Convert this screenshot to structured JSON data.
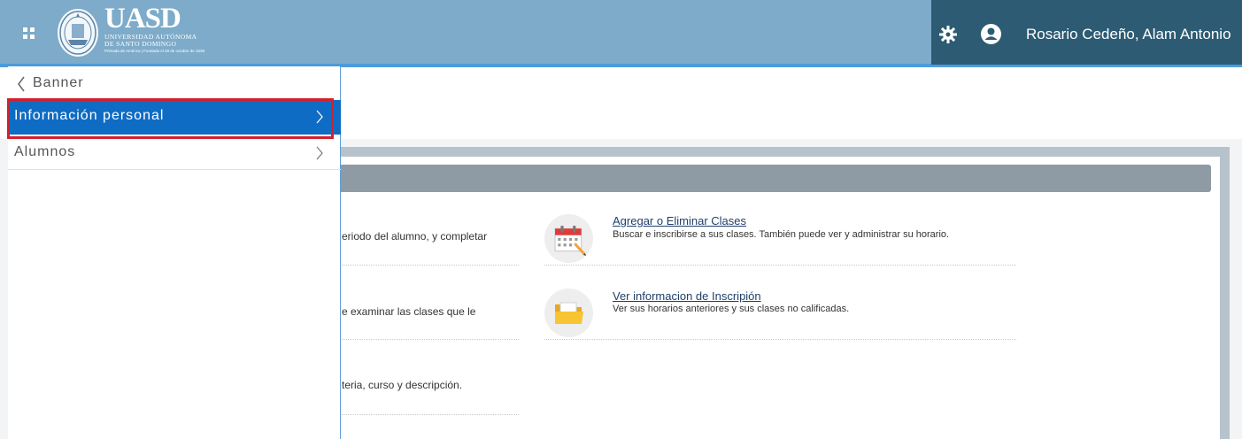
{
  "header": {
    "brand_name": "UASD",
    "brand_line1": "UNIVERSIDAD AUTÓNOMA",
    "brand_line2": "DE SANTO DOMINGO",
    "brand_line3": "Primada de América | Fundada el 28 de octubre de 1538",
    "user_name": "Rosario Cedeño, Alam Antonio",
    "icons": [
      "apps-grid-icon",
      "university-seal-logo",
      "gear-icon",
      "user-icon"
    ]
  },
  "side_menu": {
    "back_label": "Banner",
    "items": [
      {
        "label": "Información personal",
        "selected": true
      },
      {
        "label": "Alumnos",
        "selected": false
      }
    ]
  },
  "main": {
    "left_column": [
      {
        "text": "eriodo del alumno, y completar"
      },
      {
        "text": "e examinar las clases que le"
      },
      {
        "text": "teria, curso y descripción."
      }
    ],
    "tasks": [
      {
        "title": "Agregar o Eliminar Clases",
        "description": "Buscar e inscribirse a sus clases. También puede ver y administrar su horario.",
        "icon": "calendar-icon"
      },
      {
        "title": "Ver informacion de Inscripión",
        "description": "Ver sus horarios anteriores y sus clases no calificadas.",
        "icon": "folder-icon"
      }
    ]
  },
  "colors": {
    "header_bg": "#7dabc9",
    "user_panel_bg": "#2c5b73",
    "selected_item_bg": "#0f6cc4",
    "highlight_border": "#d4202d",
    "section_bar": "#8e9ba4"
  }
}
